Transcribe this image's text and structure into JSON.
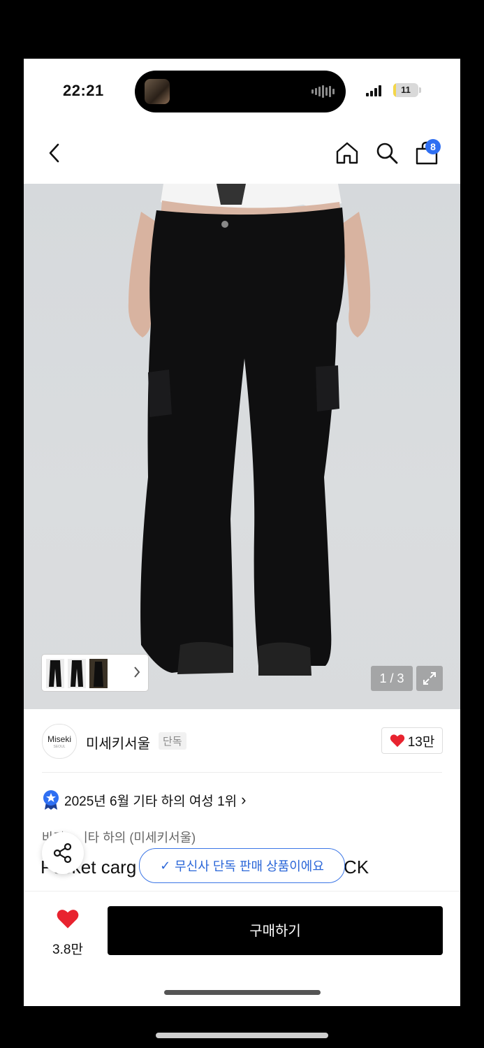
{
  "status_bar": {
    "time": "22:21",
    "battery": "11",
    "battery_level": 0.11
  },
  "nav": {
    "cart_count": "8",
    "icons": [
      "back-arrow-icon",
      "home-icon",
      "search-icon",
      "shopping-bag-icon"
    ]
  },
  "gallery": {
    "page_counter": "1 / 3",
    "thumb_count": 3
  },
  "brand": {
    "logo_text": "Miseki",
    "logo_sub": "SEOUL",
    "name": "미세키서울",
    "tag": "단독",
    "likes": "13만"
  },
  "ranking": {
    "text": "2025년 6월 기타 하의 여성 1위",
    "arrow": "›"
  },
  "product": {
    "category_prefix": "바지",
    "category": "기타 하의 (미세키서울)",
    "title_start": "Pocket carg",
    "title_end": "CK"
  },
  "toast": {
    "text": "무신사 단독 판매 상품이에요",
    "check": "✓"
  },
  "bottom_bar": {
    "wish_count": "3.8만",
    "buy_label": "구매하기"
  },
  "colors": {
    "accent_blue": "#2f6ff2",
    "heart_red": "#e8232f",
    "buy_black": "#000000"
  }
}
